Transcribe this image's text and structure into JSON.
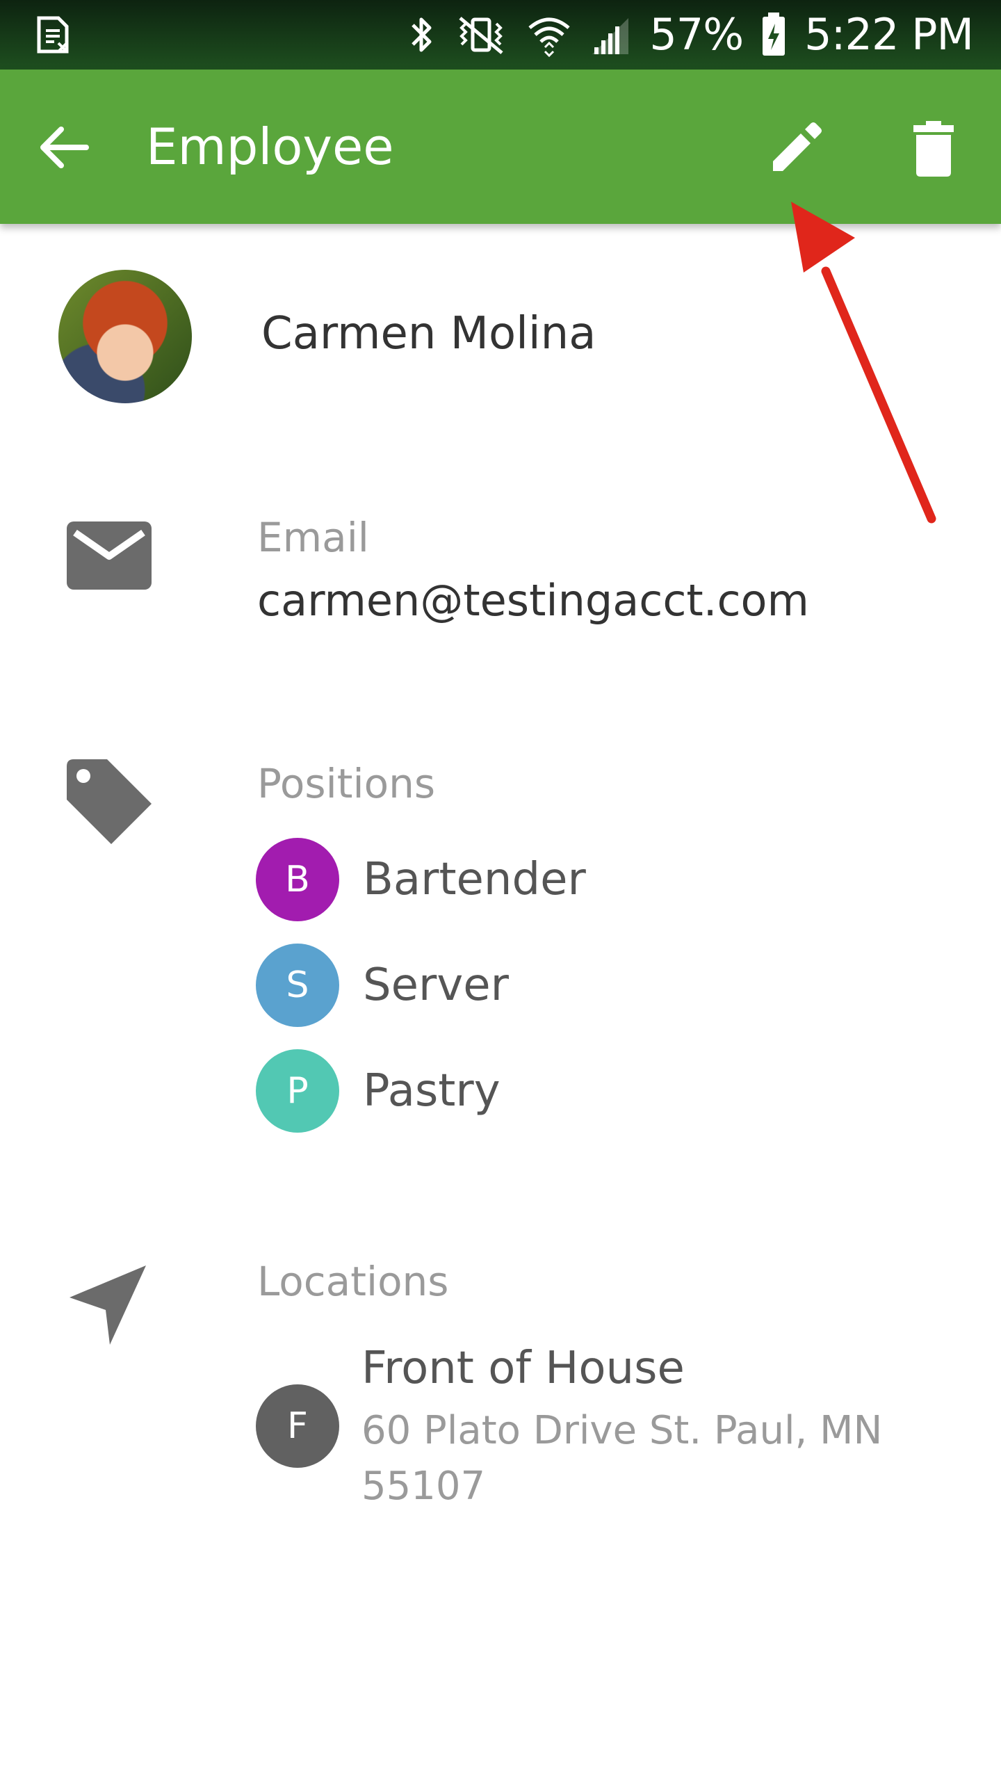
{
  "status_bar": {
    "battery": "57%",
    "time": "5:22 PM"
  },
  "app_bar": {
    "title": "Employee"
  },
  "employee": {
    "name": "Carmen Molina"
  },
  "email_section": {
    "label": "Email",
    "value": "carmen@testingacct.com"
  },
  "positions_section": {
    "label": "Positions",
    "items": [
      {
        "initial": "B",
        "name": "Bartender",
        "color": "#a21caf"
      },
      {
        "initial": "S",
        "name": "Server",
        "color": "#5aa2cf"
      },
      {
        "initial": "P",
        "name": "Pastry",
        "color": "#52c8b3"
      }
    ]
  },
  "locations_section": {
    "label": "Locations",
    "items": [
      {
        "initial": "F",
        "name": "Front of House",
        "address": "60 Plato Drive St. Paul, MN 55107",
        "color": "#616161"
      }
    ]
  },
  "colors": {
    "app_bar": "#5aa63c",
    "status_bar": "#1e4f1f",
    "annotation_arrow": "#e0261b"
  }
}
